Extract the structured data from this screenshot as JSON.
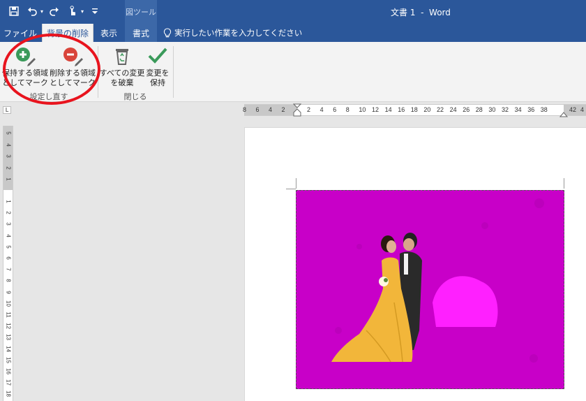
{
  "title_bar": {
    "context_tab_header": "図ツール",
    "document_title": "文書 1  -  Word"
  },
  "tabs": {
    "file": "ファイル",
    "background_removal": "背景の削除",
    "view": "表示",
    "format": "書式",
    "tell_me": "実行したい作業を入力してください"
  },
  "ribbon": {
    "mark_keep": {
      "line1": "保持する領域",
      "line2": "としてマーク"
    },
    "mark_remove": {
      "line1": "削除する領域",
      "line2": "としてマーク"
    },
    "discard_all": {
      "line1": "すべての変更",
      "line2": "を破棄"
    },
    "keep_changes": {
      "line1": "変更を",
      "line2": "保持"
    },
    "group_refine": "設定し直す",
    "group_close": "閉じる"
  },
  "ruler": {
    "corner": "L",
    "horizontal_left": [
      "8",
      "6",
      "4",
      "2"
    ],
    "horizontal_right": [
      "2",
      "4",
      "6",
      "8",
      "10",
      "12",
      "14",
      "16",
      "18",
      "20",
      "22",
      "24",
      "26",
      "28",
      "30",
      "32",
      "34",
      "36",
      "38"
    ],
    "horizontal_margin_right": [
      "42",
      "4"
    ],
    "vertical_top": [
      "5",
      "4",
      "3",
      "2",
      "1"
    ],
    "vertical_body": [
      "1",
      "2",
      "3",
      "4",
      "5",
      "6",
      "7",
      "8",
      "9",
      "10",
      "11",
      "12",
      "13",
      "14",
      "15",
      "16",
      "17",
      "18"
    ]
  },
  "colors": {
    "title_bar": "#2b579a",
    "removal_magenta": "#c800c8",
    "annotation_red": "#e8141e",
    "dress_yellow": "#f2b63a"
  },
  "icons": {
    "save": "save-icon",
    "undo": "undo-icon",
    "redo": "redo-icon",
    "touch": "touch-mode-icon",
    "customize": "customize-qat-icon",
    "lightbulb": "lightbulb-icon",
    "mark_keep": "plus-pencil-icon",
    "mark_remove": "minus-pencil-icon",
    "discard": "recycle-bin-icon",
    "keep": "checkmark-icon"
  }
}
